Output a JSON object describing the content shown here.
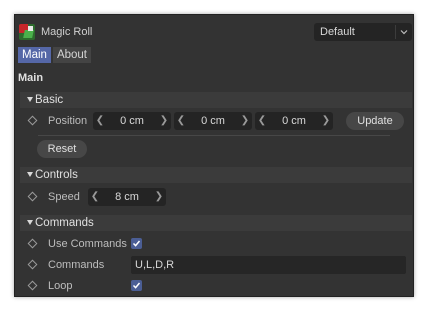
{
  "window": {
    "title": "Magic Roll",
    "preset": "Default"
  },
  "tabs": [
    {
      "label": "Main",
      "active": true
    },
    {
      "label": "About",
      "active": false
    }
  ],
  "section_title": "Main",
  "basic": {
    "header": "Basic",
    "position_label": "Position",
    "position_x": "0 cm",
    "position_y": "0 cm",
    "position_z": "0 cm",
    "update_label": "Update",
    "reset_label": "Reset"
  },
  "controls": {
    "header": "Controls",
    "speed_label": "Speed",
    "speed_value": "8 cm"
  },
  "commands": {
    "header": "Commands",
    "use_commands_label": "Use Commands",
    "use_commands_checked": true,
    "commands_label": "Commands",
    "commands_value": "U,L,D,R",
    "loop_label": "Loop",
    "loop_checked": true
  },
  "colors": {
    "accent": "#5567a7",
    "panel_bg": "#333333",
    "field_bg": "#242424"
  }
}
